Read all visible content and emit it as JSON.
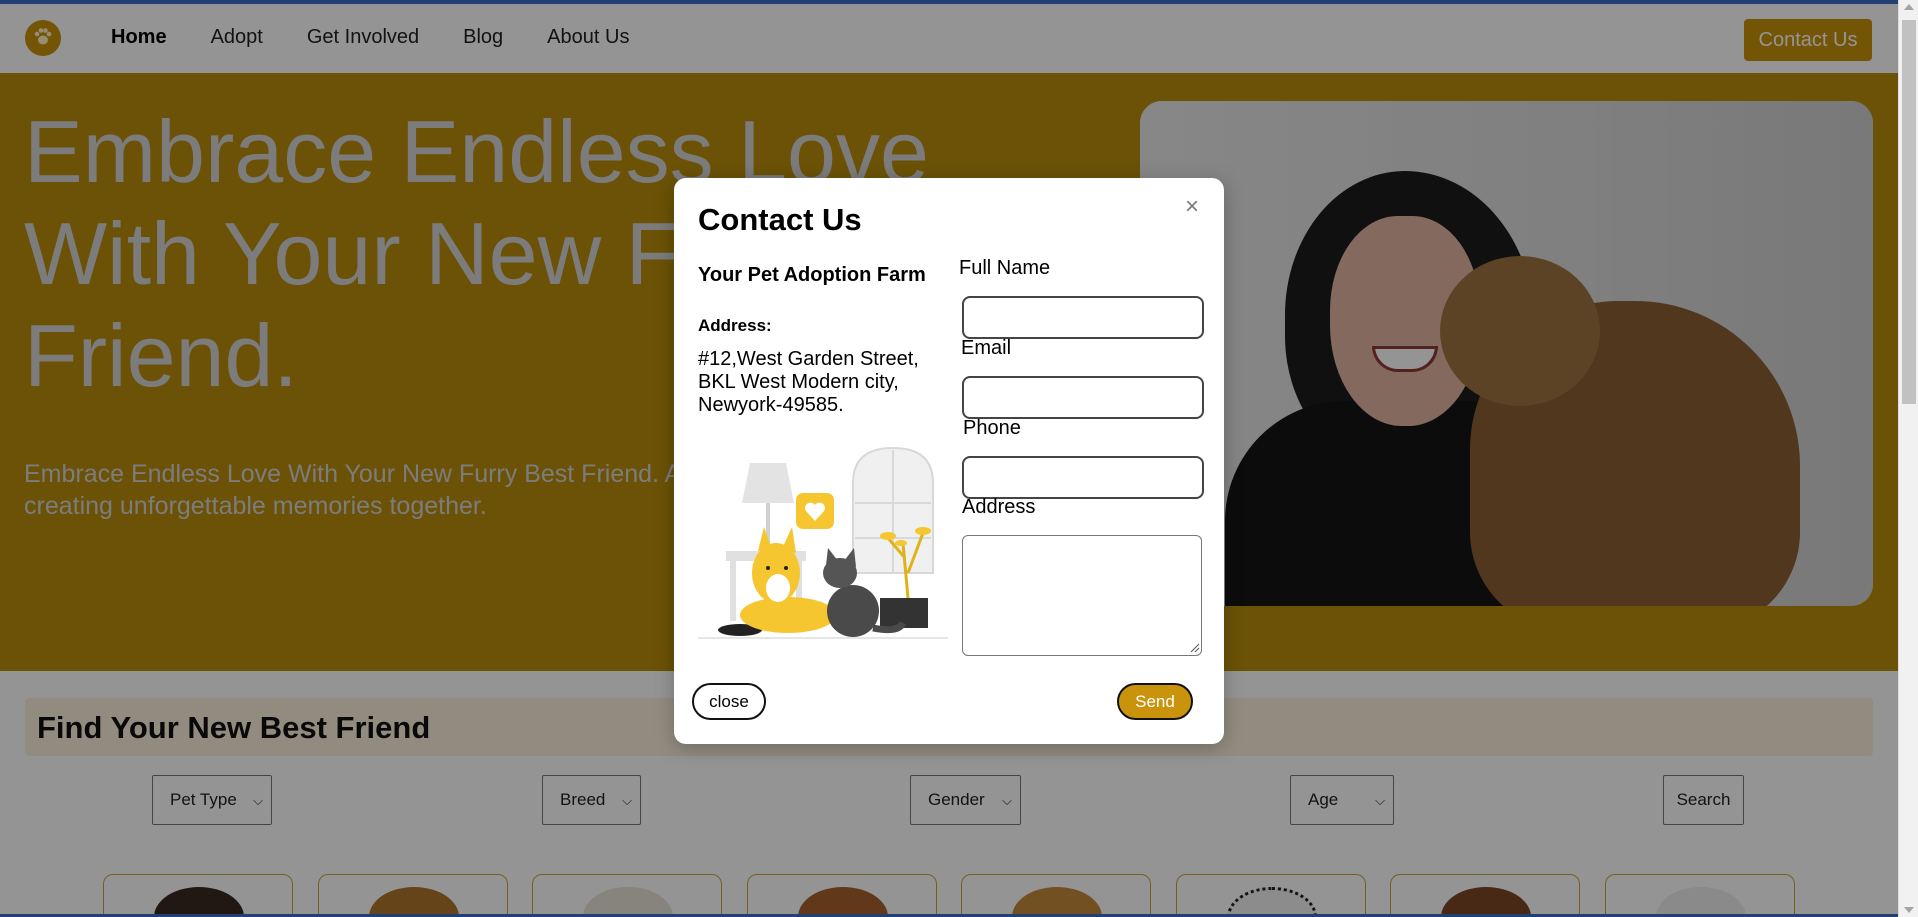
{
  "nav": {
    "logo_icon": "paw-icon",
    "links": [
      {
        "label": "Home",
        "active": true
      },
      {
        "label": "Adopt",
        "active": false
      },
      {
        "label": "Get Involved",
        "active": false
      },
      {
        "label": "Blog",
        "active": false
      },
      {
        "label": "About Us",
        "active": false
      }
    ],
    "contact_label": "Contact Us"
  },
  "hero": {
    "title": "Embrace Endless Love With Your New Furry Best Friend.",
    "subtitle": "Embrace Endless Love With Your New Furry Best Friend. Adopt now and start creating unforgettable memories together."
  },
  "finder": {
    "title": "Find Your New Best Friend",
    "filters": [
      {
        "label": "Pet Type"
      },
      {
        "label": "Breed"
      },
      {
        "label": "Gender"
      },
      {
        "label": "Age"
      }
    ],
    "search_label": "Search"
  },
  "modal": {
    "title": "Contact Us",
    "close_symbol": "×",
    "farm_name": "Your Pet Adoption Farm",
    "address_label": "Address:",
    "address_text": "#12,West Garden Street, BKL West Modern city, Newyork-49585.",
    "fields": {
      "full_name": {
        "label": "Full Name",
        "value": ""
      },
      "email": {
        "label": "Email",
        "value": ""
      },
      "phone": {
        "label": "Phone",
        "value": ""
      },
      "address": {
        "label": "Address",
        "value": ""
      }
    },
    "close_button": "close",
    "send_button": "Send"
  },
  "colors": {
    "brand": "#c9930c",
    "hero_bg": "#b98d0b",
    "finder_bar": "#fbf2dc"
  }
}
